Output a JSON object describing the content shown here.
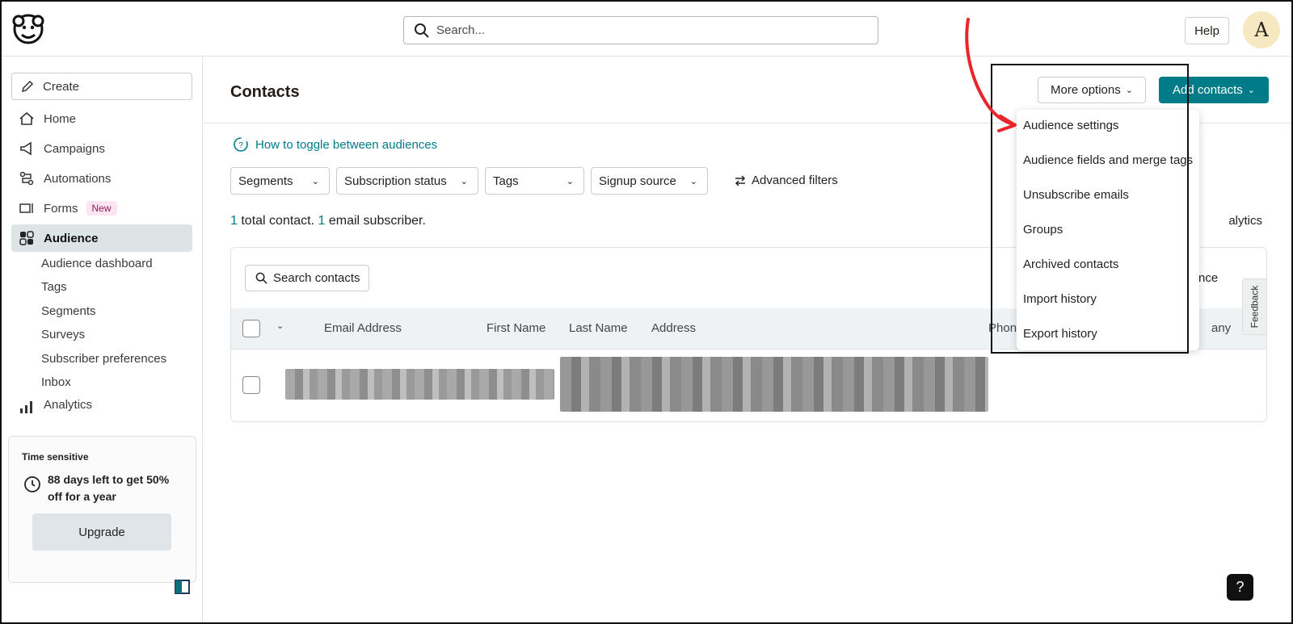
{
  "header": {
    "search_placeholder": "Search...",
    "help_label": "Help",
    "avatar_initial": "A"
  },
  "sidebar": {
    "create_label": "Create",
    "items": [
      {
        "label": "Home",
        "icon": "home-icon"
      },
      {
        "label": "Campaigns",
        "icon": "megaphone-icon"
      },
      {
        "label": "Automations",
        "icon": "automation-icon"
      },
      {
        "label": "Forms",
        "icon": "form-icon",
        "badge": "New"
      },
      {
        "label": "Audience",
        "icon": "audience-icon",
        "active": true
      }
    ],
    "audience_subitems": [
      "Audience dashboard",
      "Tags",
      "Segments",
      "Surveys",
      "Subscriber preferences",
      "Inbox"
    ],
    "analytics_label": "Analytics",
    "promo": {
      "tag": "Time sensitive",
      "text": "88 days left to get 50% off for a year",
      "button": "Upgrade"
    }
  },
  "main": {
    "title": "Contacts",
    "more_options_label": "More options",
    "add_contacts_label": "Add contacts",
    "toggle_link": "How to toggle between audiences",
    "filters": [
      "Segments",
      "Subscription status",
      "Tags",
      "Signup source"
    ],
    "advanced_filters": "Advanced filters",
    "summary": {
      "contacts_count": "1",
      "contacts_text": " total contact. ",
      "subscribers_count": "1",
      "subscribers_text": " email subscriber."
    },
    "analytics_partial": "alytics",
    "search_contacts": "Search contacts",
    "partial_right": "nce",
    "columns": [
      "Email Address",
      "First Name",
      "Last Name",
      "Address",
      "Phone",
      "any"
    ],
    "feedback": "Feedback",
    "help_q": "?"
  },
  "dropdown": {
    "items": [
      "Audience settings",
      "Audience fields and merge tags",
      "Unsubscribe emails",
      "Groups",
      "Archived contacts",
      "Import history",
      "Export history"
    ]
  },
  "colors": {
    "accent": "#007c89",
    "annotation_arrow": "#e8262a",
    "active_nav_bg": "#dde4e6"
  }
}
